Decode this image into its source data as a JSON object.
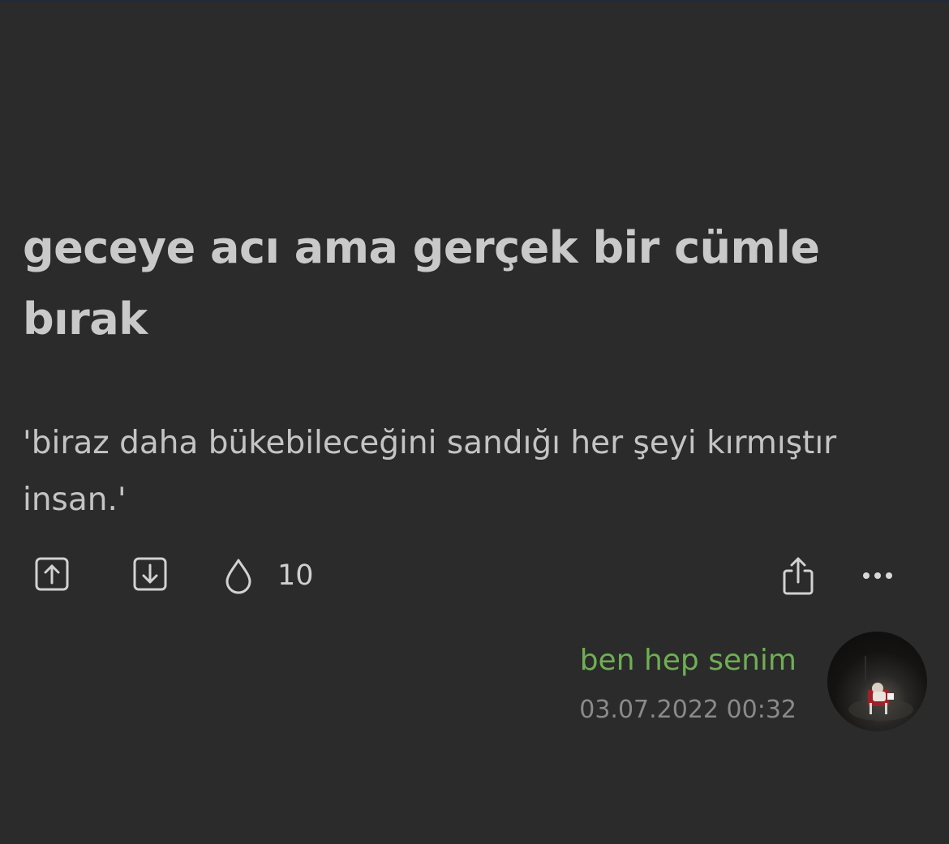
{
  "post": {
    "title": "geceye acı ama gerçek bir cümle bırak",
    "body": "'biraz daha bükebileceğini sandığı her şeyi kırmıştır insan.'"
  },
  "actions": {
    "upvote_icon": "arrow-up-square-icon",
    "downvote_icon": "arrow-down-square-icon",
    "drop_icon": "water-drop-icon",
    "drop_count": "10",
    "share_icon": "share-icon",
    "more_icon": "more-dots-icon"
  },
  "author": {
    "name": "ben hep senim",
    "timestamp": "03.07.2022 00:32"
  },
  "colors": {
    "background": "#2b2b2b",
    "text": "#c9c9c9",
    "author_name": "#6fae53",
    "timestamp": "#8a8a8a"
  }
}
